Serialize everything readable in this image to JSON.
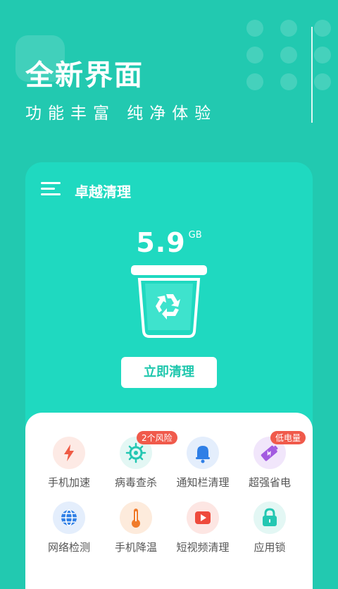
{
  "banner": {
    "headline": "全新界面",
    "subline": "功能丰富  纯净体验"
  },
  "app": {
    "title": "卓越清理",
    "junk_size": "5.9",
    "junk_unit": "GB",
    "clean_button": "立即清理"
  },
  "tools": [
    {
      "label": "手机加速",
      "icon": "lightning-icon",
      "badge": ""
    },
    {
      "label": "病毒查杀",
      "icon": "virus-icon",
      "badge": "2个风险"
    },
    {
      "label": "通知栏清理",
      "icon": "bell-icon",
      "badge": ""
    },
    {
      "label": "超强省电",
      "icon": "battery-icon",
      "badge": "低电量"
    },
    {
      "label": "网络检测",
      "icon": "globe-icon",
      "badge": ""
    },
    {
      "label": "手机降温",
      "icon": "thermometer-icon",
      "badge": ""
    },
    {
      "label": "短视频清理",
      "icon": "play-icon",
      "badge": ""
    },
    {
      "label": "应用锁",
      "icon": "lock-icon",
      "badge": ""
    }
  ],
  "colors": {
    "background": "#22c9b0",
    "card": "#1fd9c0",
    "badge": "#f05a4b",
    "accent": "#1fc7ad"
  }
}
